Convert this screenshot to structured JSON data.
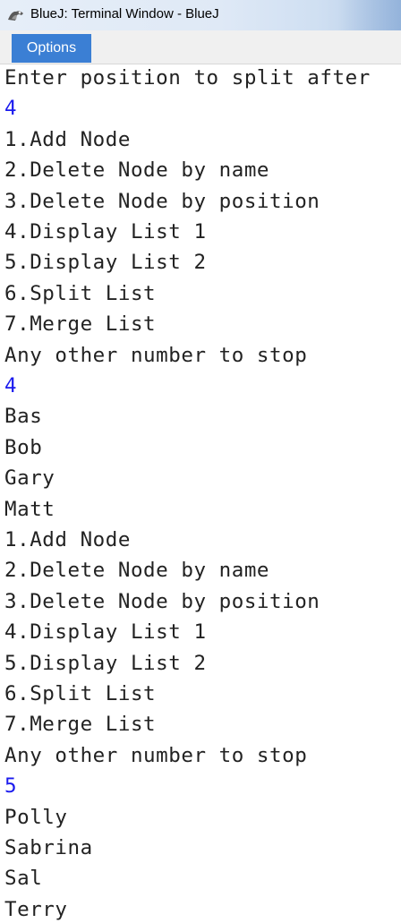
{
  "window": {
    "title": "BlueJ: Terminal Window - BlueJ",
    "icon": "bluej-app-icon"
  },
  "menu": {
    "items": [
      {
        "label": "Options"
      }
    ]
  },
  "terminal": {
    "input_color": "#1a1aee",
    "output_color": "#222222",
    "lines": [
      {
        "text": "Enter position to split after",
        "type": "output"
      },
      {
        "text": "4",
        "type": "input"
      },
      {
        "text": "1.Add Node",
        "type": "output"
      },
      {
        "text": "2.Delete Node by name",
        "type": "output"
      },
      {
        "text": "3.Delete Node by position",
        "type": "output"
      },
      {
        "text": "4.Display List 1",
        "type": "output"
      },
      {
        "text": "5.Display List 2",
        "type": "output"
      },
      {
        "text": "6.Split List",
        "type": "output"
      },
      {
        "text": "7.Merge List",
        "type": "output"
      },
      {
        "text": "Any other number to stop",
        "type": "output"
      },
      {
        "text": "4",
        "type": "input"
      },
      {
        "text": "Bas",
        "type": "output"
      },
      {
        "text": "Bob",
        "type": "output"
      },
      {
        "text": "Gary",
        "type": "output"
      },
      {
        "text": "Matt",
        "type": "output"
      },
      {
        "text": "1.Add Node",
        "type": "output"
      },
      {
        "text": "2.Delete Node by name",
        "type": "output"
      },
      {
        "text": "3.Delete Node by position",
        "type": "output"
      },
      {
        "text": "4.Display List 1",
        "type": "output"
      },
      {
        "text": "5.Display List 2",
        "type": "output"
      },
      {
        "text": "6.Split List",
        "type": "output"
      },
      {
        "text": "7.Merge List",
        "type": "output"
      },
      {
        "text": "Any other number to stop",
        "type": "output"
      },
      {
        "text": "5",
        "type": "input"
      },
      {
        "text": "Polly",
        "type": "output"
      },
      {
        "text": "Sabrina",
        "type": "output"
      },
      {
        "text": "Sal",
        "type": "output"
      },
      {
        "text": "Terry",
        "type": "output"
      }
    ]
  }
}
